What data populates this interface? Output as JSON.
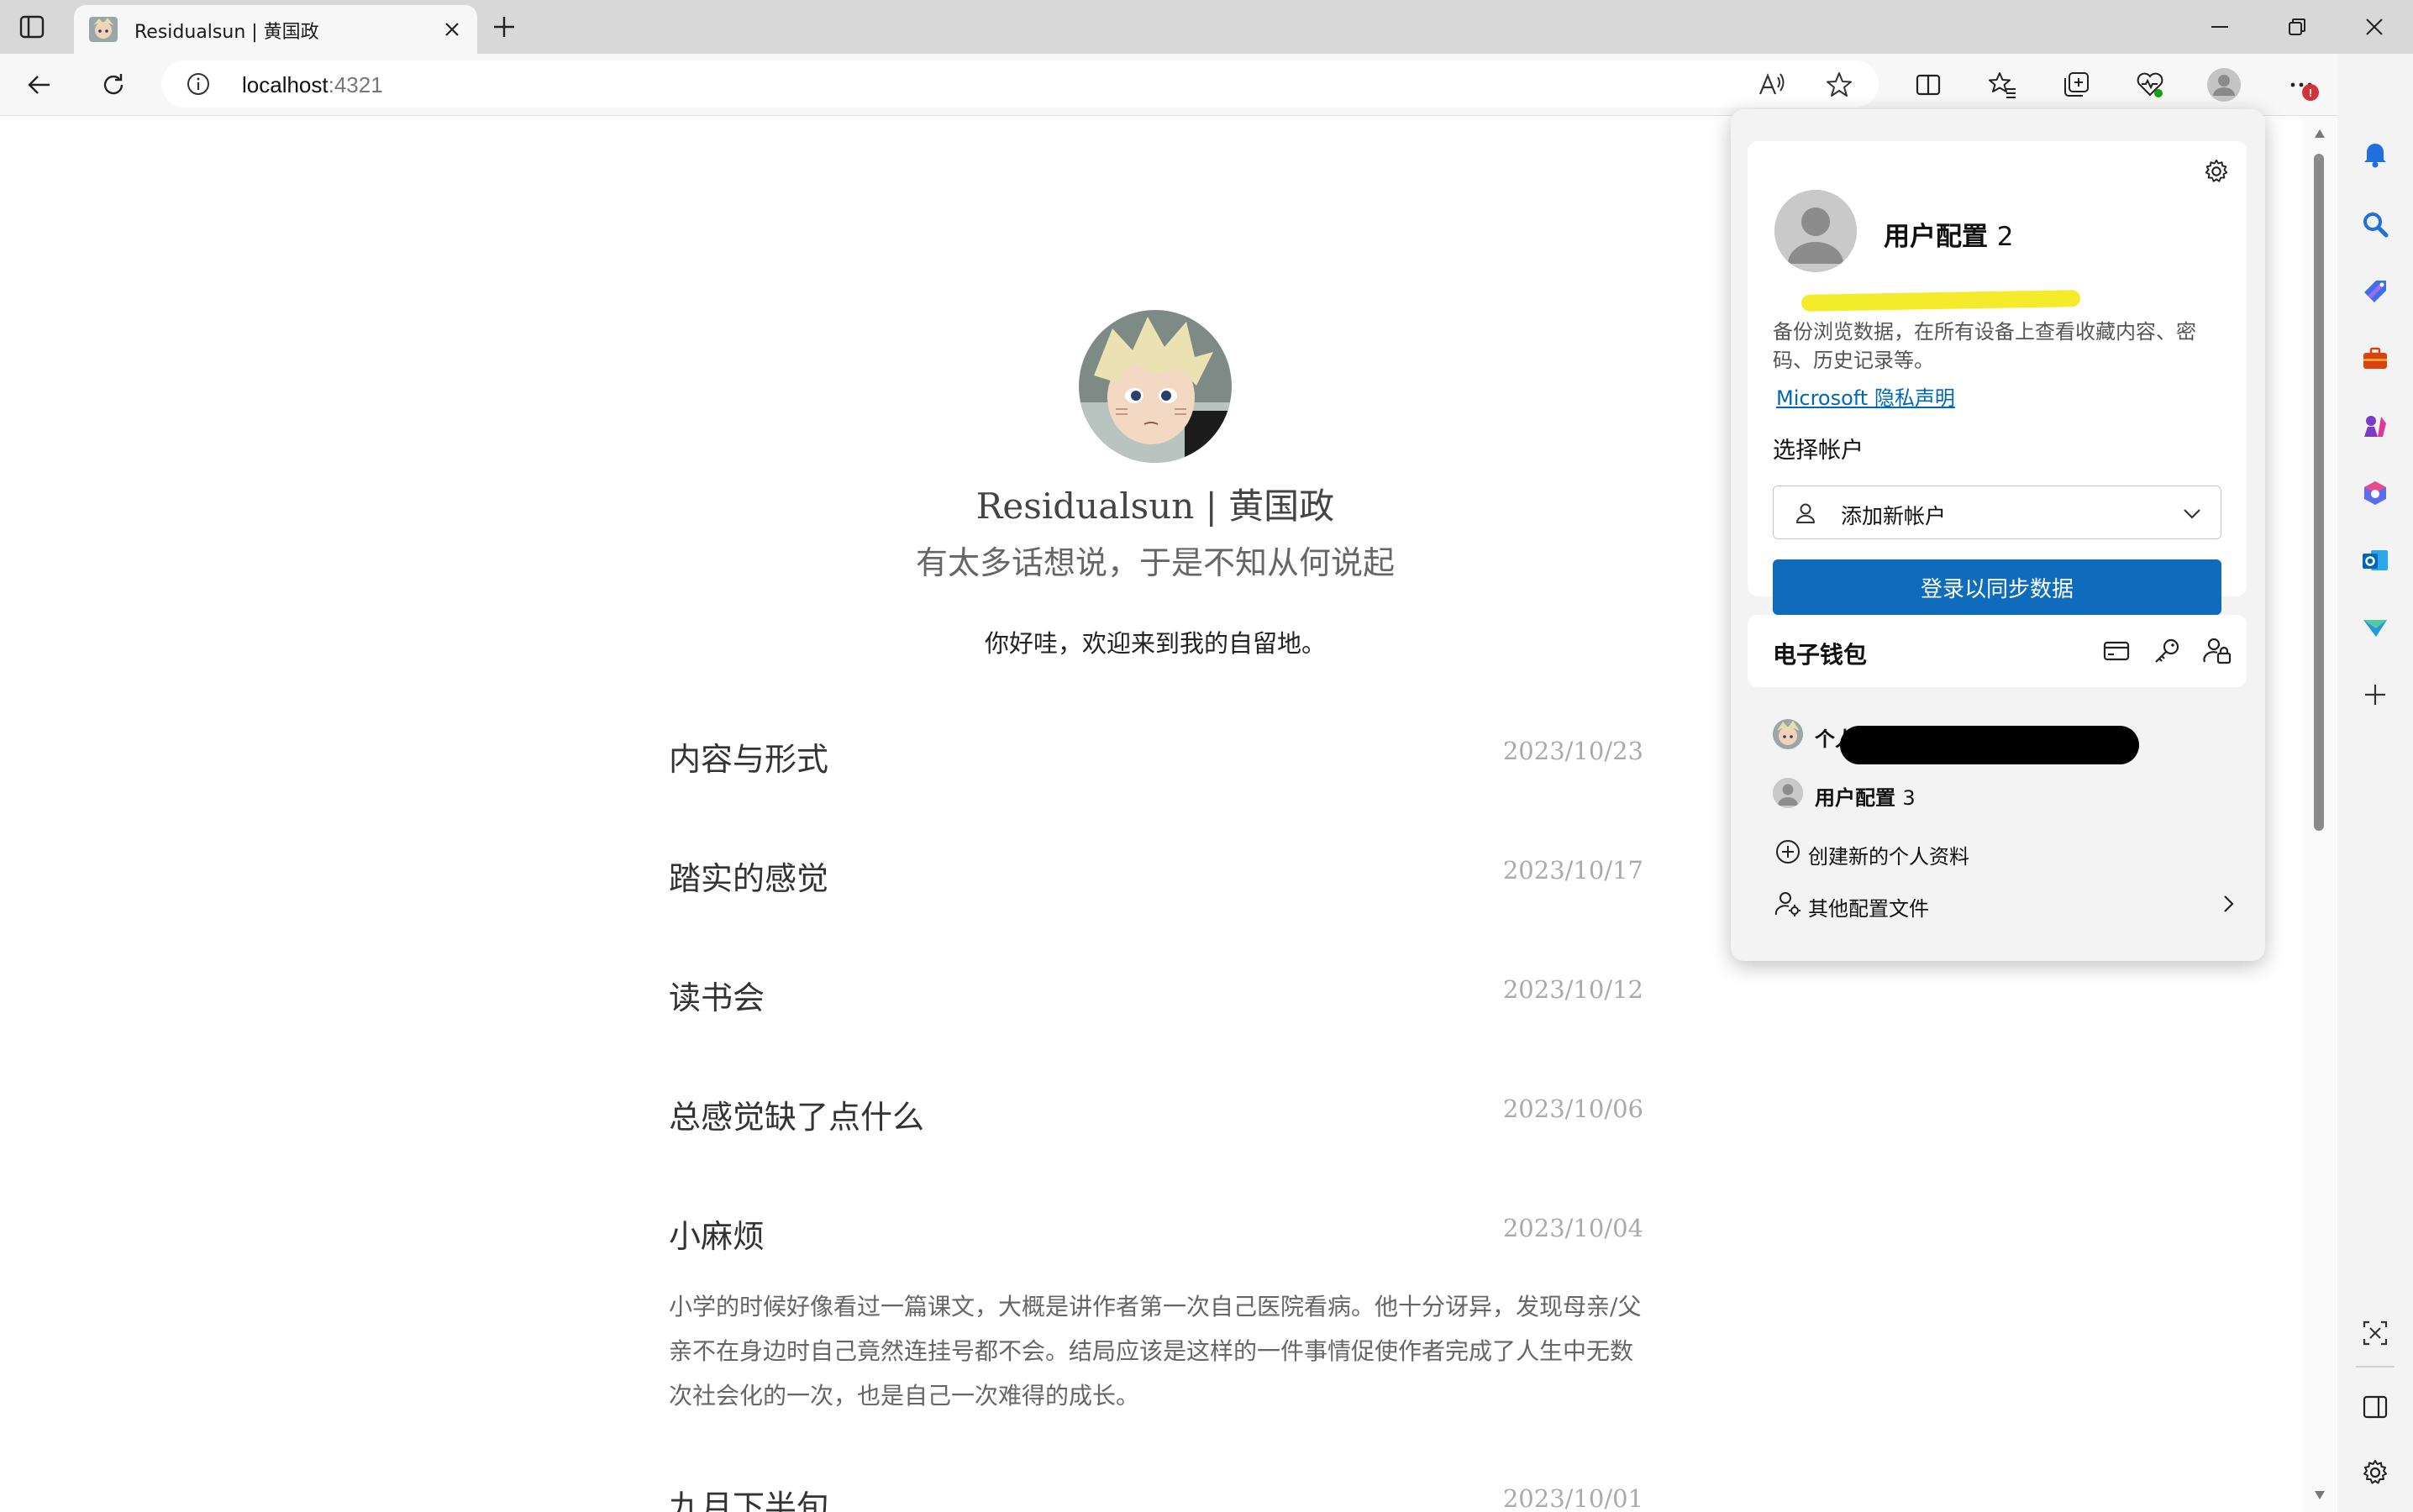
{
  "browser": {
    "tab": {
      "title": "Residualsun | 黄国政"
    },
    "address": {
      "host": "localhost",
      "port": ":4321"
    },
    "menu_badge": "!"
  },
  "page": {
    "site_title": "Residualsun | 黄国政",
    "site_subtitle": "有太多话想说，于是不知从何说起",
    "welcome": "你好哇，欢迎来到我的自留地。",
    "posts": [
      {
        "title": "内容与形式",
        "date": "2023/10/23"
      },
      {
        "title": "踏实的感觉",
        "date": "2023/10/17"
      },
      {
        "title": "读书会",
        "date": "2023/10/12"
      },
      {
        "title": "总感觉缺了点什么",
        "date": "2023/10/06"
      },
      {
        "title": "小麻烦",
        "date": "2023/10/04",
        "excerpt": "小学的时候好像看过一篇课文，大概是讲作者第一次自己医院看病。他十分讶异，发现母亲/父亲不在身边时自己竟然连挂号都不会。结局应该是这样的一件事情促使作者完成了人生中无数次社会化的一次，也是自己一次难得的成长。"
      },
      {
        "title": "九月下半旬",
        "date": "2023/10/01"
      }
    ]
  },
  "profile_flyout": {
    "profile_name": "用户配置",
    "profile_num": "2",
    "description": "备份浏览数据，在所有设备上查看收藏内容、密码、历史记录等。",
    "privacy_link": "Microsoft 隐私声明",
    "choose_account_label": "选择帐户",
    "account_select_value": "添加新帐户",
    "sign_in_button": "登录以同步数据",
    "wallet_title": "电子钱包",
    "other_profiles": [
      {
        "label": "个人",
        "avatar": "anime"
      },
      {
        "label": "用户配置",
        "num": "3",
        "avatar": "generic"
      }
    ],
    "create_profile": "创建新的个人资料",
    "other_profile_files": "其他配置文件"
  },
  "colors": {
    "accent": "#0f6cbd",
    "highlight": "#f4ec2a",
    "link": "#0067b8"
  },
  "icons": {
    "toolbar": [
      "back-icon",
      "refresh-icon",
      "info-icon",
      "read-aloud-icon",
      "favorite-star-icon",
      "split-screen-icon",
      "favorites-icon",
      "collections-icon",
      "browser-essentials-icon",
      "profile-icon",
      "more-icon",
      "copilot-icon"
    ],
    "sidebar": [
      "notifications-icon",
      "search-icon",
      "shopping-icon",
      "tools-icon",
      "games-icon",
      "microsoft-365-icon",
      "outlook-icon",
      "drop-icon",
      "add-icon",
      "screenshot-icon",
      "sidebar-toggle-icon",
      "settings-icon"
    ]
  }
}
